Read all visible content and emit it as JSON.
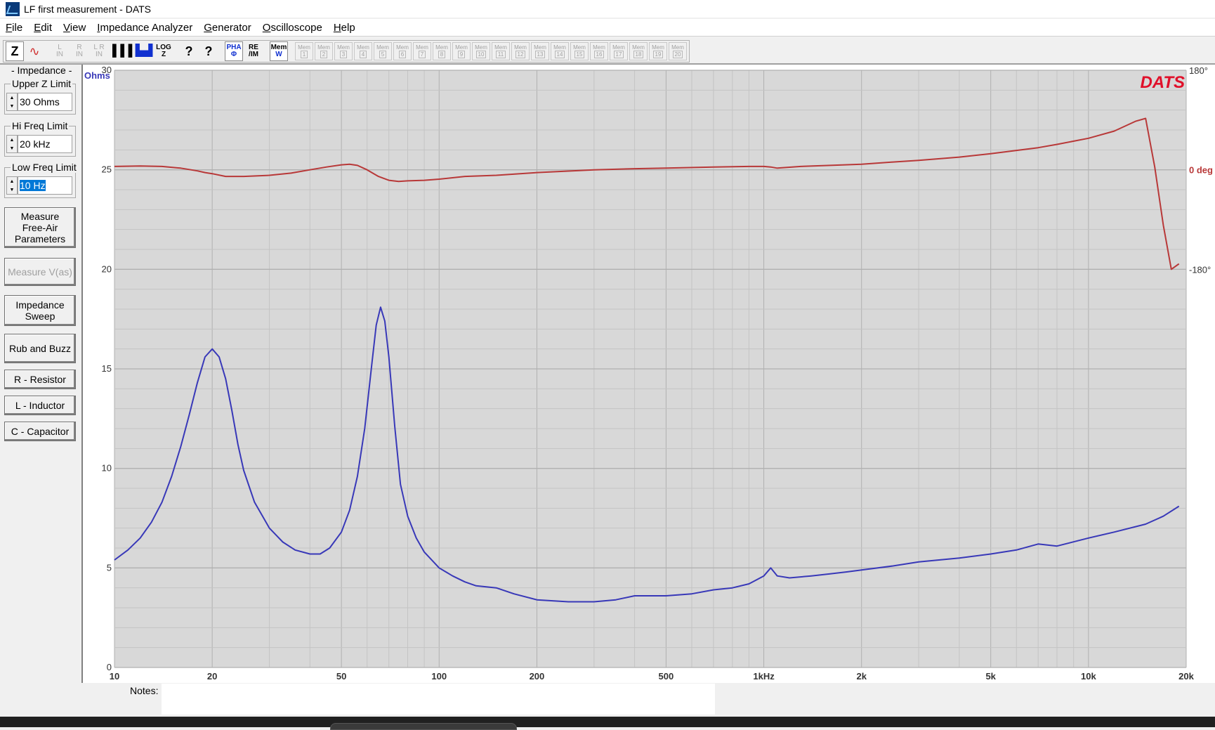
{
  "window": {
    "title": "LF first measurement - DATS"
  },
  "menu": [
    {
      "label": "File",
      "ul": "F",
      "rest": "ile",
      "name": "menu-file"
    },
    {
      "label": "Edit",
      "ul": "E",
      "rest": "dit",
      "name": "menu-edit"
    },
    {
      "label": "View",
      "ul": "V",
      "rest": "iew",
      "name": "menu-view"
    },
    {
      "label": "Impedance Analyzer",
      "ul": "I",
      "rest": "mpedance Analyzer",
      "name": "menu-impedance-analyzer"
    },
    {
      "label": "Generator",
      "ul": "G",
      "rest": "enerator",
      "name": "menu-generator"
    },
    {
      "label": "Oscilloscope",
      "ul": "O",
      "rest": "scilloscope",
      "name": "menu-oscilloscope"
    },
    {
      "label": "Help",
      "ul": "H",
      "rest": "elp",
      "name": "menu-help"
    }
  ],
  "toolbar": {
    "z": "Z",
    "wave": "∿",
    "l_in_top": "L",
    "l_in_bot": "IN",
    "r_in_top": "R",
    "r_in_bot": "IN",
    "lr_in_top": "L R",
    "lr_in_bot": "IN",
    "bars": "▌▌▌",
    "blue": "▙▟",
    "logz_top": "LOG",
    "logz_bot": "Z",
    "help1": "?",
    "help2": "?",
    "pha_top": "PHA",
    "pha_bot": "Φ",
    "reim_top": "RE",
    "reim_bot": "/IM",
    "memw_top": "Mem",
    "memw_bot": "W",
    "mem_label": "Mem",
    "mem_slots": [
      "1",
      "2",
      "3",
      "4",
      "5",
      "6",
      "7",
      "8",
      "9",
      "10",
      "11",
      "12",
      "13",
      "14",
      "15",
      "16",
      "17",
      "18",
      "19",
      "20"
    ]
  },
  "sidebar": {
    "impedance_title": "- Impedance -",
    "upper_z_label": "Upper Z Limit",
    "upper_z_value": "30 Ohms",
    "hi_freq_label": "Hi Freq Limit",
    "hi_freq_value": "20 kHz",
    "low_freq_label": "Low Freq Limit",
    "low_freq_value": "10 Hz",
    "btn_measure_free_air_1": "Measure",
    "btn_measure_free_air_2": "Free-Air",
    "btn_measure_free_air_3": "Parameters",
    "btn_measure_vas": "Measure V(as)",
    "btn_impedance_sweep_1": "Impedance",
    "btn_impedance_sweep_2": "Sweep",
    "btn_rub_buzz": "Rub and Buzz",
    "btn_resistor": "R - Resistor",
    "btn_inductor": "L - Inductor",
    "btn_capacitor": "C - Capacitor"
  },
  "notes": {
    "label": "Notes:"
  },
  "colors": {
    "impedance": "#3838b8",
    "phase": "#b83838",
    "plot_bg": "#d8d8d8",
    "grid_major": "#b0b0b0",
    "grid_minor": "#c4c4c4",
    "brand": "#e0102a"
  },
  "chart_data": {
    "type": "line",
    "brand_label": "DATS",
    "ylabel_left": "Ohms",
    "x_scale": "log",
    "xlim": [
      10,
      20000
    ],
    "ylim": [
      0,
      30
    ],
    "y2lim": [
      -180,
      180
    ],
    "x_ticks": [
      {
        "value": 10,
        "label": "10"
      },
      {
        "value": 20,
        "label": "20"
      },
      {
        "value": 50,
        "label": "50"
      },
      {
        "value": 100,
        "label": "100"
      },
      {
        "value": 200,
        "label": "200"
      },
      {
        "value": 500,
        "label": "500"
      },
      {
        "value": 1000,
        "label": "1kHz"
      },
      {
        "value": 2000,
        "label": "2k"
      },
      {
        "value": 5000,
        "label": "5k"
      },
      {
        "value": 10000,
        "label": "10k"
      },
      {
        "value": 20000,
        "label": "20k"
      }
    ],
    "y_ticks": [
      {
        "value": 0,
        "label": "0"
      },
      {
        "value": 5,
        "label": "5"
      },
      {
        "value": 10,
        "label": "10"
      },
      {
        "value": 15,
        "label": "15"
      },
      {
        "value": 20,
        "label": "20"
      },
      {
        "value": 25,
        "label": "25"
      },
      {
        "value": 30,
        "label": "30"
      }
    ],
    "y2_ticks": [
      {
        "value": 180,
        "label": "180°"
      },
      {
        "value": 0,
        "label": "0 deg"
      },
      {
        "value": -180,
        "label": "-180°"
      }
    ],
    "grid": true,
    "series": [
      {
        "axis": "left",
        "x": [
          10,
          11,
          12,
          13,
          14,
          15,
          16,
          17,
          18,
          19,
          20,
          21,
          22,
          23,
          24,
          25,
          27,
          30,
          33,
          36,
          40,
          43,
          46,
          50,
          53,
          56,
          59,
          62,
          64,
          66,
          68,
          70,
          73,
          76,
          80,
          85,
          90,
          100,
          110,
          120,
          130,
          150,
          170,
          200,
          250,
          300,
          350,
          400,
          450,
          500,
          600,
          700,
          800,
          900,
          950,
          1000,
          1050,
          1100,
          1200,
          1400,
          1600,
          1800,
          2000,
          2500,
          3000,
          4000,
          5000,
          6000,
          7000,
          8000,
          10000,
          12000,
          15000,
          17000,
          19000
        ],
        "values": [
          5.4,
          5.9,
          6.5,
          7.3,
          8.3,
          9.6,
          11.1,
          12.7,
          14.3,
          15.6,
          16.0,
          15.6,
          14.5,
          12.9,
          11.2,
          9.9,
          8.3,
          7.0,
          6.3,
          5.9,
          5.7,
          5.7,
          6.0,
          6.8,
          7.9,
          9.6,
          12.0,
          15.2,
          17.2,
          18.1,
          17.4,
          15.6,
          12.1,
          9.2,
          7.6,
          6.5,
          5.8,
          5.0,
          4.6,
          4.3,
          4.1,
          4.0,
          3.7,
          3.4,
          3.3,
          3.3,
          3.4,
          3.6,
          3.6,
          3.6,
          3.7,
          3.9,
          4.0,
          4.2,
          4.4,
          4.6,
          5.0,
          4.6,
          4.5,
          4.6,
          4.7,
          4.8,
          4.9,
          5.1,
          5.3,
          5.5,
          5.7,
          5.9,
          6.2,
          6.1,
          6.5,
          6.8,
          7.2,
          7.6,
          8.1
        ]
      },
      {
        "axis": "right",
        "x": [
          10,
          12,
          14,
          16,
          18,
          19,
          20,
          22,
          25,
          30,
          35,
          40,
          45,
          50,
          53,
          56,
          60,
          65,
          70,
          75,
          80,
          90,
          100,
          120,
          150,
          200,
          300,
          400,
          500,
          700,
          900,
          1000,
          1050,
          1100,
          1300,
          1600,
          2000,
          2500,
          3000,
          4000,
          5000,
          6000,
          7000,
          8000,
          10000,
          12000,
          14000,
          15000,
          16000,
          17000,
          18000,
          19000
        ],
        "values": [
          6,
          7,
          6,
          3,
          -2,
          -5,
          -7,
          -12,
          -12,
          -10,
          -6,
          0,
          5,
          9,
          10,
          8,
          0,
          -12,
          -19,
          -21,
          -20,
          -19,
          -17,
          -12,
          -10,
          -5,
          0,
          2,
          3,
          5,
          6,
          6,
          5,
          3,
          6,
          8,
          10,
          14,
          17,
          23,
          29,
          35,
          40,
          46,
          57,
          70,
          88,
          93,
          5,
          -100,
          -180,
          -170
        ]
      }
    ]
  }
}
